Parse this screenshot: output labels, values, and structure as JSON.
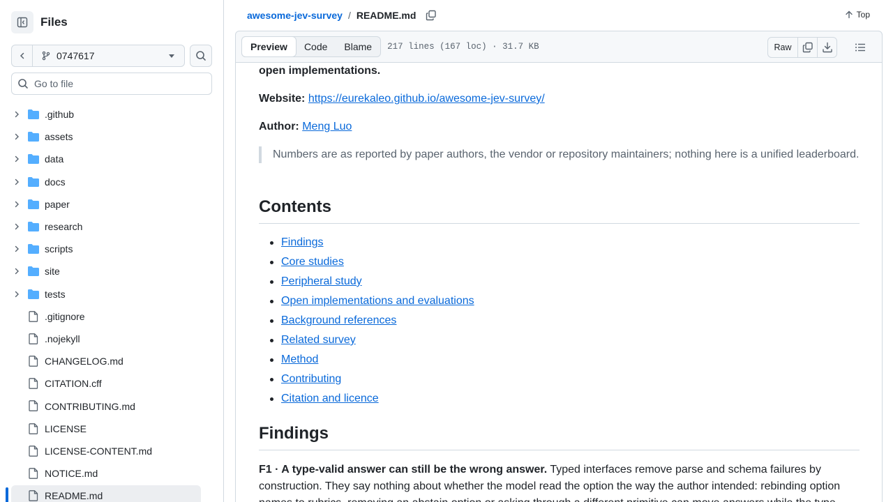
{
  "sidebar": {
    "title": "Files",
    "branch": "0747617",
    "search_placeholder": "Go to file",
    "items": [
      {
        "label": ".github",
        "type": "folder"
      },
      {
        "label": "assets",
        "type": "folder"
      },
      {
        "label": "data",
        "type": "folder"
      },
      {
        "label": "docs",
        "type": "folder"
      },
      {
        "label": "paper",
        "type": "folder"
      },
      {
        "label": "research",
        "type": "folder"
      },
      {
        "label": "scripts",
        "type": "folder"
      },
      {
        "label": "site",
        "type": "folder"
      },
      {
        "label": "tests",
        "type": "folder"
      },
      {
        "label": ".gitignore",
        "type": "file"
      },
      {
        "label": ".nojekyll",
        "type": "file"
      },
      {
        "label": "CHANGELOG.md",
        "type": "file"
      },
      {
        "label": "CITATION.cff",
        "type": "file"
      },
      {
        "label": "CONTRIBUTING.md",
        "type": "file"
      },
      {
        "label": "LICENSE",
        "type": "file"
      },
      {
        "label": "LICENSE-CONTENT.md",
        "type": "file"
      },
      {
        "label": "NOTICE.md",
        "type": "file"
      },
      {
        "label": "README.md",
        "type": "file",
        "active": true
      }
    ]
  },
  "breadcrumb": {
    "repo": "awesome-jev-survey",
    "separator": "/",
    "file": "README.md",
    "top_label": "Top"
  },
  "file_header": {
    "tabs": [
      "Preview",
      "Code",
      "Blame"
    ],
    "active_tab": "Preview",
    "meta": "217 lines (167 loc) · 31.7 KB",
    "raw_label": "Raw"
  },
  "readme": {
    "top_line": "open implementations.",
    "website_label": "Website:",
    "website_url": "https://eurekaleo.github.io/awesome-jev-survey/",
    "author_label": "Author:",
    "author_name": "Meng Luo",
    "quote": "Numbers are as reported by paper authors, the vendor or repository maintainers; nothing here is a unified leaderboard.",
    "contents_heading": "Contents",
    "toc": [
      "Findings",
      "Core studies",
      "Peripheral study",
      "Open implementations and evaluations",
      "Background references",
      "Related survey",
      "Method",
      "Contributing",
      "Citation and licence"
    ],
    "findings_heading": "Findings",
    "f1_title": "F1 · A type-valid answer can still be the wrong answer.",
    "f1_text": " Typed interfaces remove parse and schema failures by construction. They say nothing about whether the model read the option the way the author intended: rebinding option names to rubrics, removing an abstain option or asking through a different primitive can move answers while the type"
  },
  "colors": {
    "link": "#0969da",
    "folder": "#54aeff",
    "border": "#d1d9e0",
    "text": "#1f2328",
    "muted": "#59636e"
  }
}
